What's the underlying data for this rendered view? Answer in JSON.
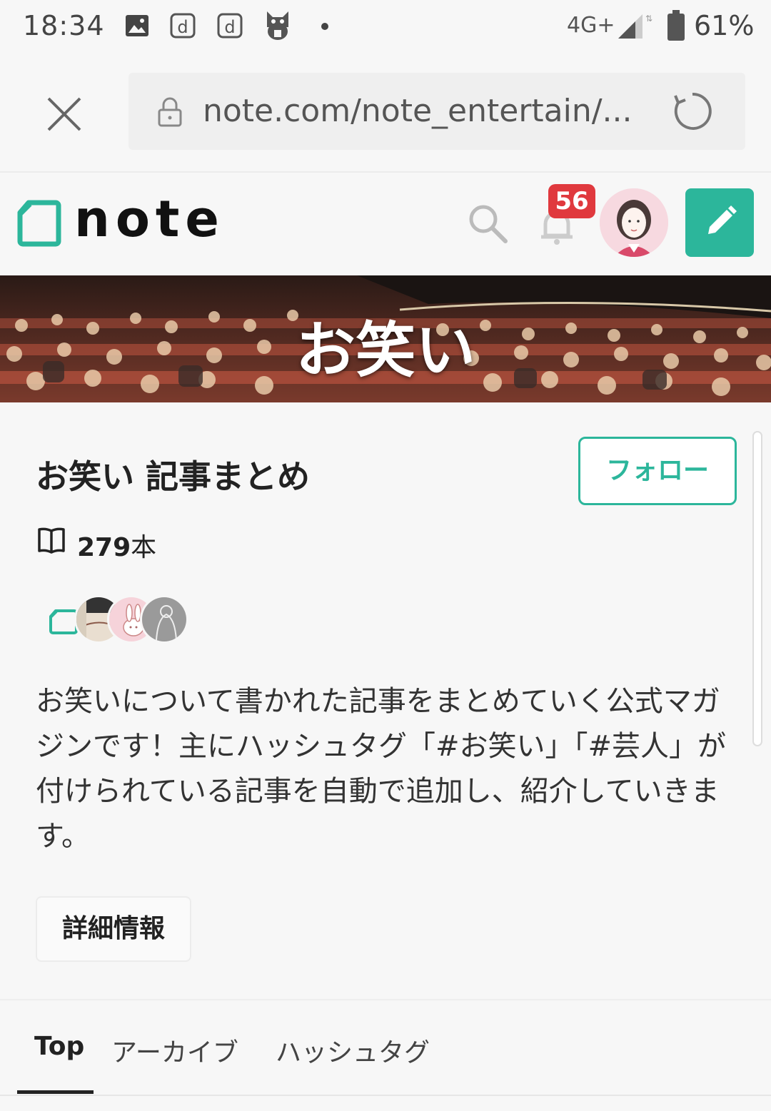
{
  "status_bar": {
    "time": "18:34",
    "network": "4G+",
    "battery": "61%",
    "icons": [
      "gallery-icon",
      "d-app-icon",
      "d-app-icon",
      "cat-app-icon",
      "dot-indicator",
      "signal-icon",
      "battery-icon"
    ]
  },
  "browser": {
    "url": "note.com/note_entertain/...",
    "icons": [
      "close-icon",
      "lock-icon",
      "reload-icon"
    ]
  },
  "header": {
    "logo_text": "note",
    "notification_count": "56",
    "brand_color": "#2cb69b",
    "icons": [
      "search-icon",
      "bell-icon",
      "pencil-icon"
    ]
  },
  "banner": {
    "title": "お笑い"
  },
  "magazine": {
    "title": "お笑い 記事まとめ",
    "follow_label": "フォロー",
    "count_number": "279",
    "count_unit": "本",
    "description": "お笑いについて書かれた記事をまとめていく公式マガジンです！主にハッシュタグ「#お笑い」「#芸人」が付けられている記事を自動で追加し、紹介していきます。",
    "detail_label": "詳細情報"
  },
  "tabs": [
    {
      "label": "Top",
      "active": true
    },
    {
      "label": "アーカイブ",
      "active": false
    },
    {
      "label": "ハッシュタグ",
      "active": false
    }
  ]
}
